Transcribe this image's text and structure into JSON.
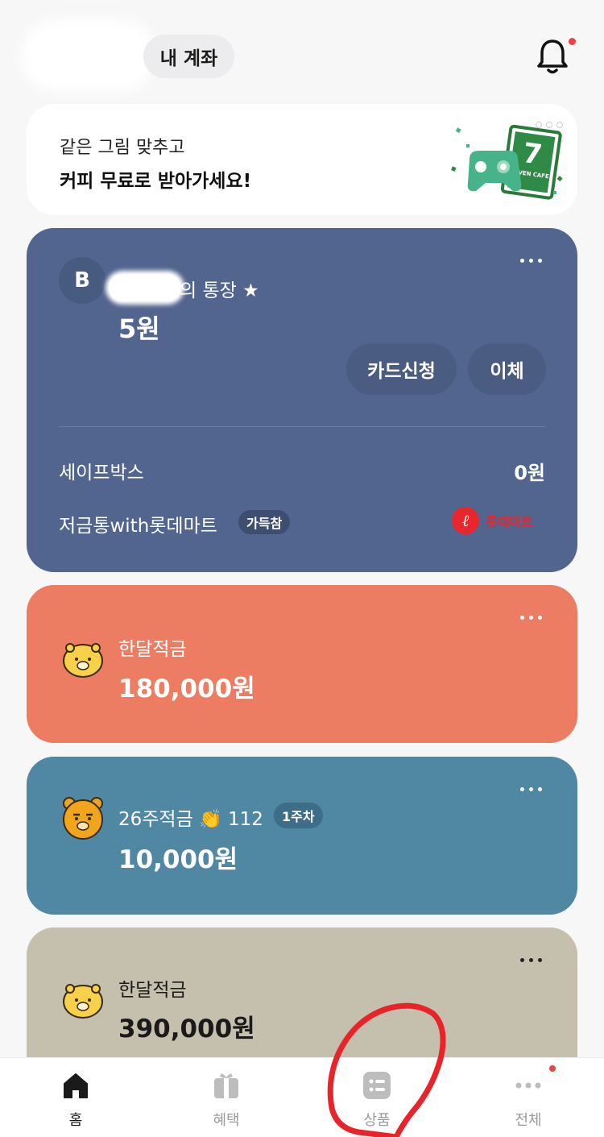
{
  "header": {
    "my_account_label": "내 계좌"
  },
  "banner": {
    "line1": "같은 그림 맞추고",
    "line2": "커피 무료로 받아가세요!",
    "art_label": "SEVEN CAFE",
    "art_number": "7"
  },
  "main_account": {
    "bank_logo": "B",
    "name_suffix": "의 통장 ★",
    "balance": "5원",
    "card_apply_label": "카드신청",
    "transfer_label": "이체",
    "safebox_label": "세이프박스",
    "safebox_value": "0원",
    "piggy_label": "저금통with롯데마트",
    "piggy_badge": "가득참",
    "partner_logo_text": "롯데마트"
  },
  "savings": [
    {
      "title": "한달적금",
      "amount": "180,000원",
      "color": "#ec7d62"
    },
    {
      "title": "26주적금 👏 112",
      "badge": "1주차",
      "amount": "10,000원",
      "color": "#5087a3"
    },
    {
      "title": "한달적금",
      "amount": "390,000원",
      "color": "#c5bfae"
    }
  ],
  "tabbar": {
    "tabs": [
      {
        "label": "홈",
        "icon": "home-icon",
        "active": true
      },
      {
        "label": "혜택",
        "icon": "gift-icon",
        "active": false
      },
      {
        "label": "상품",
        "icon": "product-list-icon",
        "active": false
      },
      {
        "label": "전체",
        "icon": "more-dots-icon",
        "active": false
      }
    ]
  },
  "colors": {
    "main_card": "#52658e",
    "notification_dot": "#f04040",
    "annotation_circle": "#e8242a"
  }
}
